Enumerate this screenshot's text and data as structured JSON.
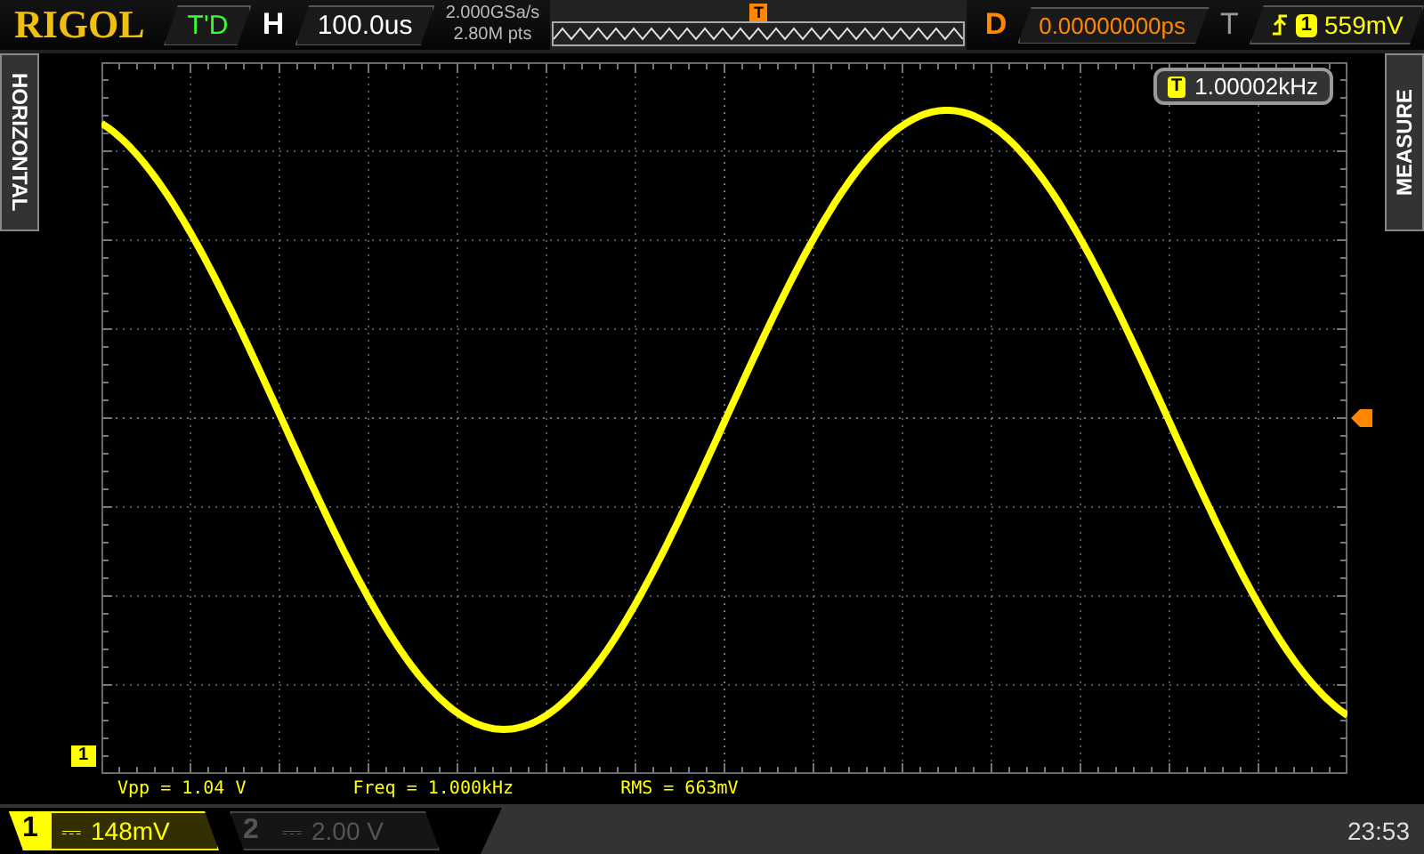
{
  "brand": "RIGOL",
  "status": "T'D",
  "timebase": {
    "label": "H",
    "value": "100.0us"
  },
  "sample_rate": "2.000GSa/s",
  "memory_depth": "2.80M pts",
  "delay": {
    "label": "D",
    "value": "0.00000000ps"
  },
  "trigger": {
    "label": "T",
    "channel": "1",
    "level": "559mV"
  },
  "side_tabs": {
    "left": "HORIZONTAL",
    "right": "MEASURE"
  },
  "trigger_position_marker": "T",
  "freq_counter": {
    "badge": "T",
    "value": "1.00002kHz"
  },
  "channel_marker": "1",
  "measurements": [
    {
      "text": "Vpp = 1.04 V"
    },
    {
      "text": "Freq = 1.000kHz"
    },
    {
      "text": "RMS = 663mV"
    }
  ],
  "channels": [
    {
      "number": "1",
      "coupling": "⎓",
      "scale": "148mV",
      "on": true
    },
    {
      "number": "2",
      "coupling": "⎓",
      "scale": "2.00 V",
      "on": false
    }
  ],
  "clock": "23:53"
}
